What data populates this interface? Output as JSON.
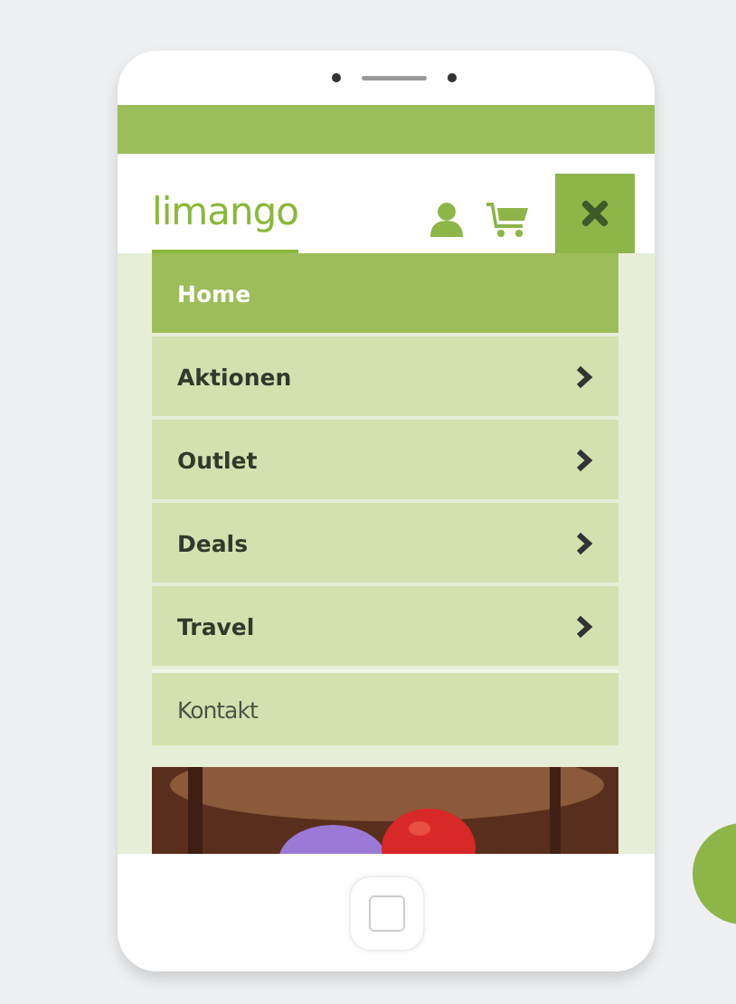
{
  "header": {
    "logo": "limango"
  },
  "menu": [
    {
      "label": "Home",
      "kind": "page",
      "selected": true
    },
    {
      "label": "Aktionen",
      "kind": "category",
      "selected": false
    },
    {
      "label": "Outlet",
      "kind": "category",
      "selected": false
    },
    {
      "label": "Deals",
      "kind": "category",
      "selected": false
    },
    {
      "label": "Travel",
      "kind": "category",
      "selected": false
    },
    {
      "label": "Kontakt",
      "kind": "secondary",
      "selected": false
    }
  ]
}
